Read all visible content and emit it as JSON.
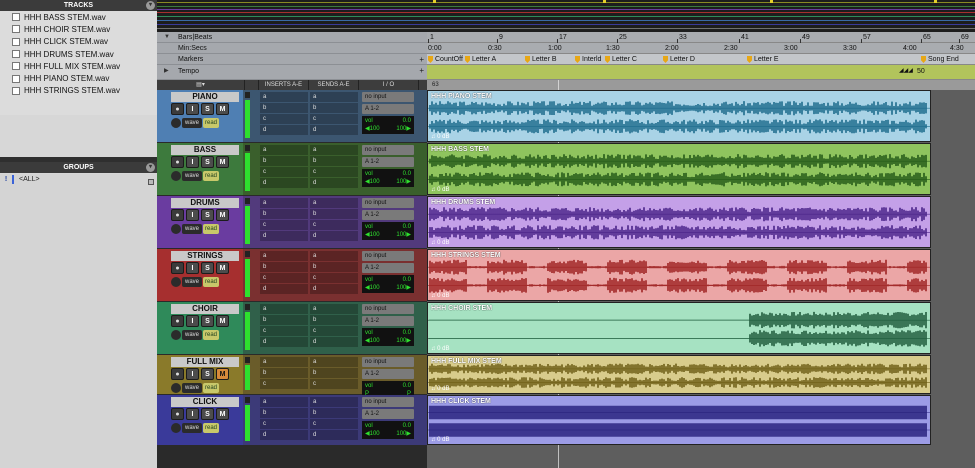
{
  "tracks_panel": {
    "title": "TRACKS",
    "items": [
      "HHH BASS STEM.wav",
      "HHH CHOIR STEM.wav",
      "HHH CLICK STEM.wav",
      "HHH DRUMS STEM.wav",
      "HHH FULL MIX STEM.wav",
      "HHH PIANO STEM.wav",
      "HHH STRINGS STEM.wav"
    ]
  },
  "groups_panel": {
    "title": "GROUPS",
    "items": [
      {
        "id": "!",
        "name": "<ALL>"
      }
    ]
  },
  "rulers": {
    "bars_label": "Bars|Beats",
    "minsec_label": "Min:Secs",
    "markers_label": "Markers",
    "tempo_label": "Tempo",
    "bars_ticks": [
      "1",
      "9",
      "17",
      "25",
      "33",
      "41",
      "49",
      "57",
      "65",
      "69"
    ],
    "minsec_ticks": [
      "0:00",
      "0:30",
      "1:00",
      "1:30",
      "2:00",
      "2:30",
      "3:00",
      "3:30",
      "4:00",
      "4:30"
    ],
    "markers": [
      "CountOff",
      "Letter A",
      "Letter B",
      "Interld",
      "Letter C",
      "Letter D",
      "Letter E",
      "Song End"
    ],
    "tempo_value": "50",
    "tempo_start": "63"
  },
  "mix_header": {
    "inserts": "INSERTS A-E",
    "sends": "SENDS A-E",
    "io": "I / O"
  },
  "mix_tracks": [
    {
      "name": "PIANO",
      "region": "HHH PIANO STEM",
      "color": "#4f7fb3",
      "wave_bg": "#a9d3e6",
      "wave": "#1d6b8c",
      "mix_tint": "#3c5670",
      "input": "no input",
      "output": "A 1-2",
      "vol": "0.0",
      "pan_l": "◀100",
      "pan_r": "100▶",
      "gain": "0 dB",
      "muted": false
    },
    {
      "name": "BASS",
      "region": "HHH BASS STEM",
      "color": "#3d7a3d",
      "wave_bg": "#8fc45e",
      "wave": "#245a18",
      "mix_tint": "#3a5f2c",
      "input": "no input",
      "output": "A 1-2",
      "vol": "0.0",
      "pan_l": "◀100",
      "pan_r": "100▶",
      "gain": "0 dB",
      "muted": false
    },
    {
      "name": "DRUMS",
      "region": "HHH DRUMS STEM",
      "color": "#6a3ca0",
      "wave_bg": "#c4a0e8",
      "wave": "#4a2388",
      "mix_tint": "#523a7c",
      "input": "no input",
      "output": "A 1-2",
      "vol": "0.0",
      "pan_l": "◀100",
      "pan_r": "100▶",
      "gain": "0 dB",
      "muted": false
    },
    {
      "name": "STRINGS",
      "region": "HHH STRINGS STEM",
      "color": "#a62f2f",
      "wave_bg": "#eba6a6",
      "wave": "#9e2323",
      "mix_tint": "#7a3030",
      "input": "no input",
      "output": "A 1-2",
      "vol": "0.0",
      "pan_l": "◀100",
      "pan_r": "100▶",
      "gain": "0 dB",
      "muted": false
    },
    {
      "name": "CHOIR",
      "region": "HHH CHOIR STEM",
      "color": "#2f8a5a",
      "wave_bg": "#a6e2c2",
      "wave": "#1f5c3c",
      "mix_tint": "#30604a",
      "input": "no input",
      "output": "A 1-2",
      "vol": "0.0",
      "pan_l": "◀100",
      "pan_r": "100▶",
      "gain": "0 dB",
      "muted": false
    },
    {
      "name": "FULL MIX",
      "region": "HHH FULL MIX STEM",
      "color": "#8a7a2a",
      "wave_bg": "#d8cc8c",
      "wave": "#6e5e16",
      "mix_tint": "#6a5c2a",
      "input": "no input",
      "output": "A 1-2",
      "vol": "0.0",
      "pan_l": "P",
      "pan_r": "P",
      "gain": "0 dB",
      "muted": true
    },
    {
      "name": "CLICK",
      "region": "HHH CLICK STEM",
      "color": "#3a3a9a",
      "wave_bg": "#9c9ce6",
      "wave": "#241e7a",
      "mix_tint": "#3c3a78",
      "input": "no input",
      "output": "A 1-2",
      "vol": "0.0",
      "pan_l": "◀100",
      "pan_r": "100▶",
      "gain": "0 dB",
      "muted": false
    }
  ],
  "labels": {
    "rec": "●",
    "input_mon": "I",
    "solo": "S",
    "mute": "M",
    "view": "wave",
    "auto": "read",
    "vol_prefix": "vol",
    "slots": [
      "a",
      "b",
      "c",
      "d"
    ]
  }
}
